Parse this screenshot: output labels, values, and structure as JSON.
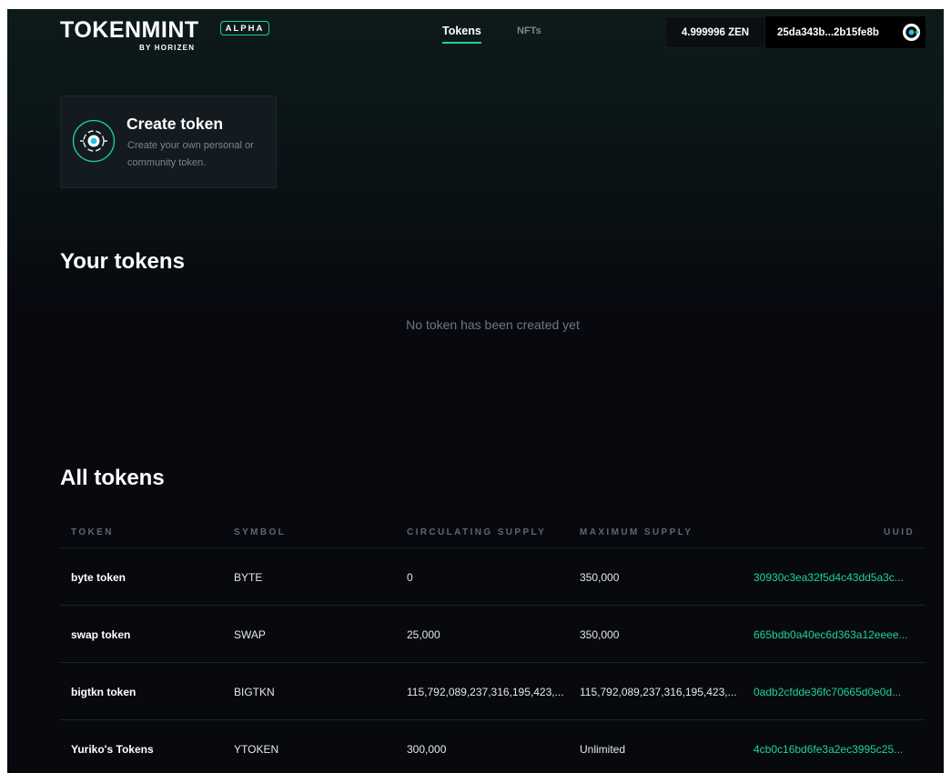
{
  "header": {
    "logo_text": "TOKENMINT",
    "logo_subtext": "BY HORIZEN",
    "badge": "ALPHA",
    "tabs": [
      {
        "label": "Tokens",
        "active": true
      },
      {
        "label": "NFTs",
        "active": false
      }
    ],
    "balance": "4.999996 ZEN",
    "wallet_address": "25da343b...2b15fe8b",
    "wallet_icon": "horizen-logo-icon"
  },
  "create_card": {
    "title": "Create token",
    "description": "Create your own personal or community token.",
    "icon": "create-token-icon"
  },
  "your_tokens": {
    "title": "Your tokens",
    "empty_message": "No token has been created yet"
  },
  "all_tokens": {
    "title": "All tokens",
    "columns": [
      "TOKEN",
      "SYMBOL",
      "CIRCULATING SUPPLY",
      "MAXIMUM SUPPLY",
      "UUID"
    ],
    "rows": [
      {
        "token": "byte token",
        "symbol": "BYTE",
        "circulating": "0",
        "maximum": "350,000",
        "uuid": "30930c3ea32f5d4c43dd5a3c..."
      },
      {
        "token": "swap token",
        "symbol": "SWAP",
        "circulating": "25,000",
        "maximum": "350,000",
        "uuid": "665bdb0a40ec6d363a12eeee..."
      },
      {
        "token": "bigtkn token",
        "symbol": "BIGTKN",
        "circulating": "115,792,089,237,316,195,423,...",
        "maximum": "115,792,089,237,316,195,423,...",
        "uuid": "0adb2cfdde36fc70665d0e0d..."
      },
      {
        "token": "Yuriko's Tokens",
        "symbol": "YTOKEN",
        "circulating": "300,000",
        "maximum": "Unlimited",
        "uuid": "4cb0c16bd6fe3a2ec3995c25..."
      }
    ]
  },
  "colors": {
    "accent": "#1fd29a",
    "background": "#07090f",
    "card": "#141b20",
    "muted_text": "#7b848c"
  }
}
